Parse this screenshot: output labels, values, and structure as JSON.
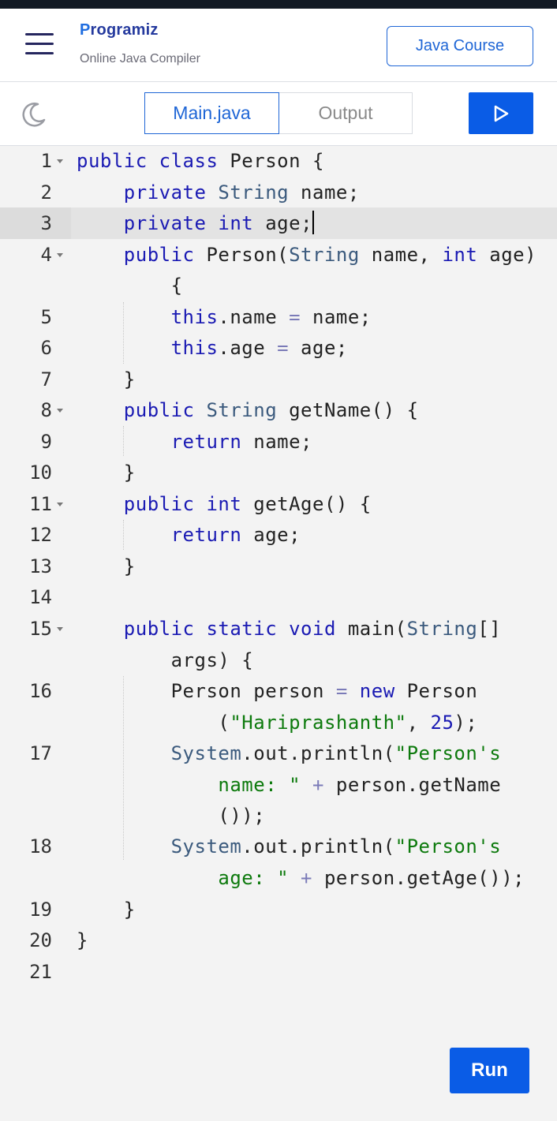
{
  "header": {
    "logo_text": "Programiz",
    "subtitle": "Online Java Compiler",
    "course_button": "Java Course"
  },
  "toolbar": {
    "tabs": [
      {
        "label": "Main.java",
        "active": true
      },
      {
        "label": "Output",
        "active": false
      }
    ],
    "theme_icon": "moon-icon",
    "run_icon": "play-icon"
  },
  "editor": {
    "active_line": 3,
    "lines": [
      {
        "n": "1"
      },
      {
        "n": "2"
      },
      {
        "n": "3"
      },
      {
        "n": "4"
      },
      {
        "n": "5"
      },
      {
        "n": "6"
      },
      {
        "n": "7"
      },
      {
        "n": "8"
      },
      {
        "n": "9"
      },
      {
        "n": "10"
      },
      {
        "n": "11"
      },
      {
        "n": "12"
      },
      {
        "n": "13"
      },
      {
        "n": "14"
      },
      {
        "n": "15"
      },
      {
        "n": "16"
      },
      {
        "n": "17"
      },
      {
        "n": "18"
      },
      {
        "n": "19"
      },
      {
        "n": "20"
      },
      {
        "n": "21"
      }
    ],
    "code": [
      "public class Person {",
      "    private String name;",
      "    private int age;",
      "    public Person(String name, int age)",
      "        {",
      "        this.name = name;",
      "        this.age = age;",
      "    }",
      "    public String getName() {",
      "        return name;",
      "    }",
      "    public int getAge() {",
      "        return age;",
      "    }",
      "",
      "    public static void main(String[]",
      "        args) {",
      "        Person person = new Person",
      "            (\"Hariprashanth\", 25);",
      "        System.out.println(\"Person's",
      "            name: \" + person.getName",
      "            ());",
      "        System.out.println(\"Person's",
      "            age: \" + person.getAge());",
      "    }",
      "}",
      ""
    ]
  },
  "run_button": "Run",
  "colors": {
    "brand_blue": "#1f66d6",
    "run_blue": "#0a5ce6",
    "keyword": "#1a1ab3",
    "string": "#0d7a0d"
  }
}
